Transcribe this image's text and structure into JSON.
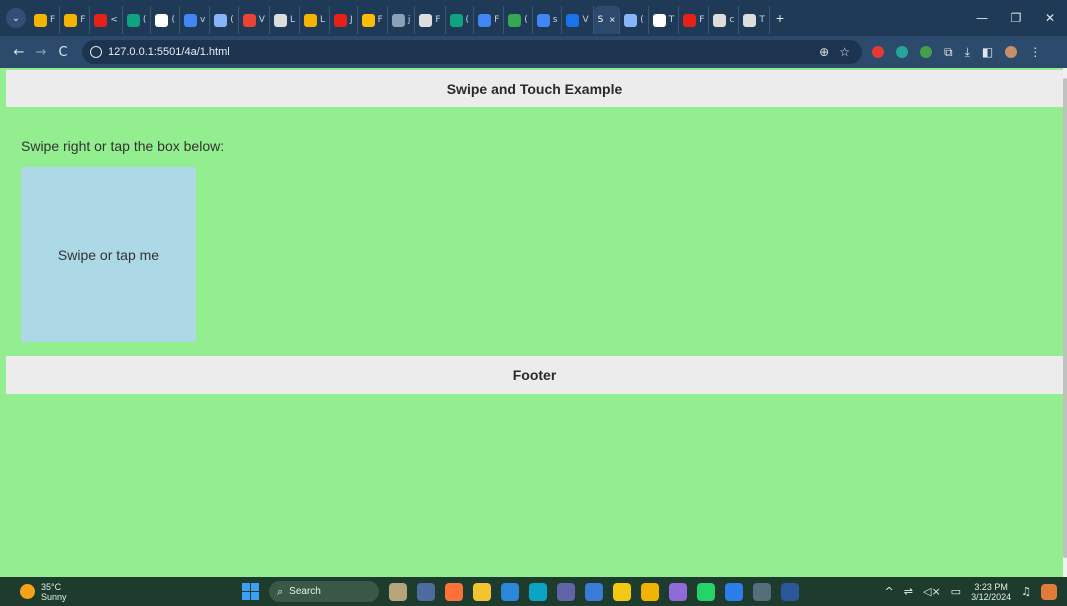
{
  "browser": {
    "tabs": [
      {
        "icon": "drive-icon",
        "color": "#f4b400",
        "label": "F"
      },
      {
        "icon": "drive-icon",
        "color": "#f4b400",
        "label": "F"
      },
      {
        "icon": "youtube-icon",
        "color": "#e62117",
        "label": "<"
      },
      {
        "icon": "chatgpt-icon",
        "color": "#10a37f",
        "label": "("
      },
      {
        "icon": "notion-icon",
        "color": "#ffffff",
        "label": "("
      },
      {
        "icon": "google-icon",
        "color": "#4285f4",
        "label": "v"
      },
      {
        "icon": "gemini-icon",
        "color": "#8ab4f8",
        "label": "("
      },
      {
        "icon": "app-icon",
        "color": "#ea4335",
        "label": "V"
      },
      {
        "icon": "github-icon",
        "color": "#dddddd",
        "label": "L"
      },
      {
        "icon": "drive-icon",
        "color": "#f4b400",
        "label": "L"
      },
      {
        "icon": "youtube-icon",
        "color": "#e62117",
        "label": "J"
      },
      {
        "icon": "chat-icon",
        "color": "#fbbc04",
        "label": "F"
      },
      {
        "icon": "app-icon",
        "color": "#8aa0b8",
        "label": "j"
      },
      {
        "icon": "github-icon",
        "color": "#dddddd",
        "label": "F"
      },
      {
        "icon": "chatgpt-icon",
        "color": "#10a37f",
        "label": "("
      },
      {
        "icon": "google-icon",
        "color": "#4285f4",
        "label": "F"
      },
      {
        "icon": "app-icon",
        "color": "#34a853",
        "label": "("
      },
      {
        "icon": "google-icon",
        "color": "#4285f4",
        "label": "s"
      },
      {
        "icon": "app-icon",
        "color": "#1a73e8",
        "label": "V"
      }
    ],
    "active_tab": {
      "label": "S",
      "close": "×"
    },
    "tabs_after": [
      {
        "icon": "gemini-icon",
        "color": "#8ab4f8",
        "label": "("
      },
      {
        "icon": "github-icon",
        "color": "#ffffff",
        "label": "T"
      },
      {
        "icon": "youtube-icon",
        "color": "#e62117",
        "label": "F"
      },
      {
        "icon": "github-icon",
        "color": "#dddddd",
        "label": "c"
      },
      {
        "icon": "app-icon",
        "color": "#dddddd",
        "label": "T"
      }
    ],
    "new_tab": "+",
    "url": "127.0.0.1:5501/4a/1.html",
    "nav": {
      "back": "←",
      "forward": "→",
      "reload": "C"
    }
  },
  "page": {
    "header": "Swipe and Touch Example",
    "instructions": "Swipe right or tap the box below:",
    "box_label": "Swipe or tap me",
    "footer": "Footer",
    "colors": {
      "background": "#93ee90",
      "box": "#add8e6",
      "header": "#ececec"
    }
  },
  "taskbar": {
    "weather_temp": "35°C",
    "weather_desc": "Sunny",
    "search_placeholder": "Search",
    "time": "3:23 PM",
    "date": "3/12/2024"
  }
}
